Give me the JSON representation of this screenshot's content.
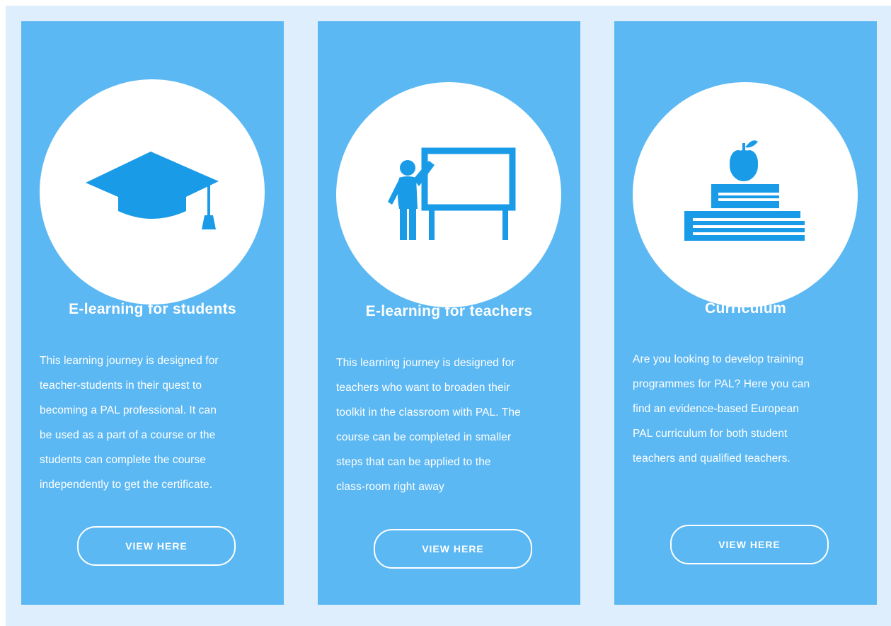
{
  "colors": {
    "page_background": "#deeefc",
    "card_background": "#5cb8f3",
    "icon_color": "#1a9be8",
    "circle_background": "#ffffff",
    "text_color": "#ffffff"
  },
  "cards": [
    {
      "icon": "graduation-cap-icon",
      "title": "E-learning for students",
      "lines": [
        "This learning journey is designed for",
        "teacher-students in their quest to",
        "becoming a PAL professional. It can",
        "be used as a part of a course or the",
        "students can complete the course",
        "independently to get the certificate."
      ],
      "button_label": "VIEW HERE"
    },
    {
      "icon": "teacher-whiteboard-icon",
      "title": "E-learning for teachers",
      "lines": [
        "This learning journey is designed for",
        "teachers who want to broaden their",
        "toolkit in the classroom with PAL. The",
        "course can be completed in smaller",
        "steps that can be applied to the",
        "class-room right away"
      ],
      "button_label": "VIEW HERE"
    },
    {
      "icon": "books-apple-icon",
      "title": "Curriculum",
      "lines": [
        "Are you looking to develop training",
        "programmes for PAL? Here you can",
        "find an evidence-based European",
        "PAL curriculum for both student",
        "teachers and qualified teachers."
      ],
      "button_label": "VIEW HERE"
    }
  ]
}
